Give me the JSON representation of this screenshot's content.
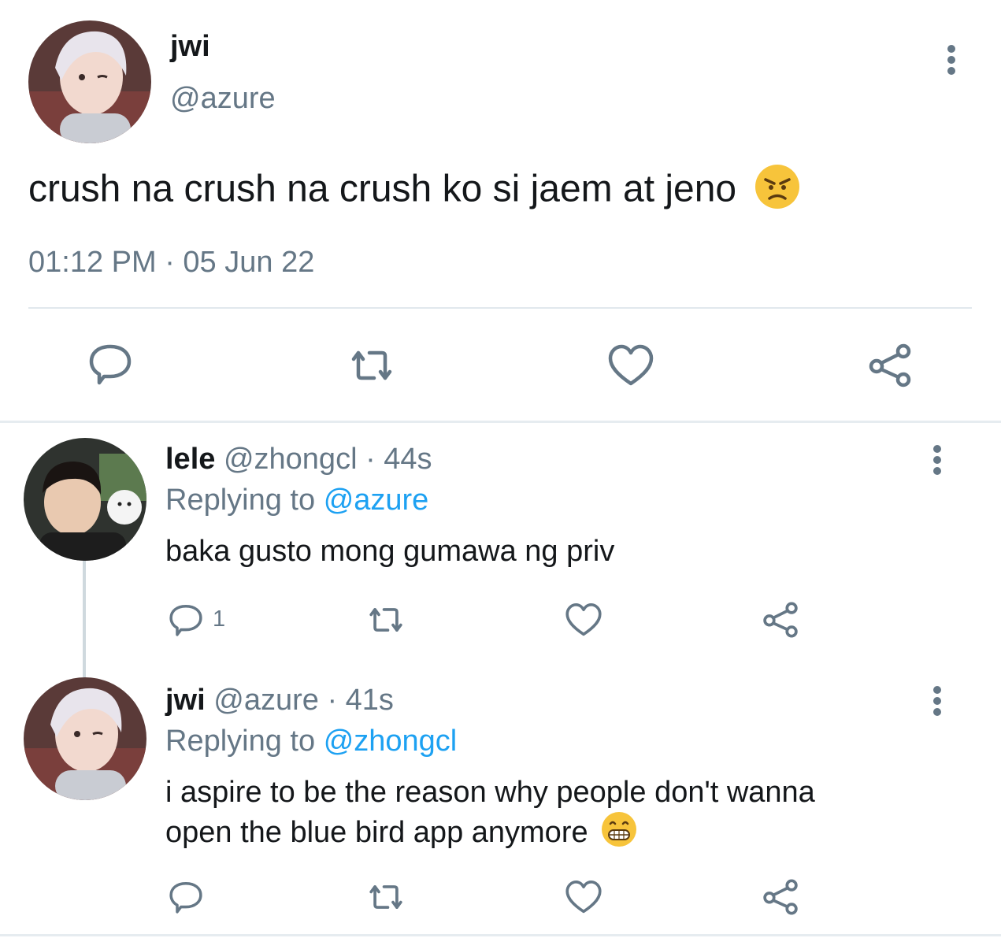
{
  "main_tweet": {
    "display_name": "jwi",
    "handle": "@azure",
    "text": "crush na crush na crush ko si jaem at jeno",
    "emoji": "angry-face",
    "timestamp": "01:12 PM · 05 Jun 22"
  },
  "replies": [
    {
      "display_name": "lele",
      "handle": "@zhongcl",
      "age": "· 44s",
      "replying_label": "Replying to",
      "replying_to": "@azure",
      "text": "baka gusto mong gumawa ng priv",
      "reply_count": "1"
    },
    {
      "display_name": "jwi",
      "handle": "@azure",
      "age": "· 41s",
      "replying_label": "Replying to",
      "replying_to": "@zhongcl",
      "text_line1": "i aspire to be the reason why people don't wanna",
      "text_line2": "open the blue bird app anymore",
      "emoji": "grinning-face"
    }
  ],
  "colors": {
    "text": "#14171a",
    "muted": "#657786",
    "link": "#1da1f2",
    "divider": "#e1e8ed",
    "icon": "#657786"
  }
}
